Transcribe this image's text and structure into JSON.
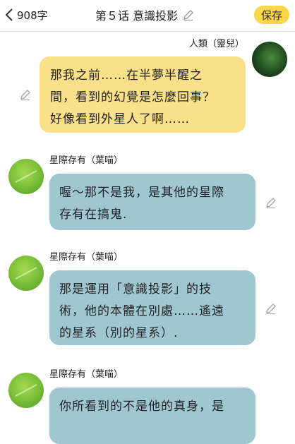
{
  "header": {
    "back_icon": "chevron-left-icon",
    "word_count": "908字",
    "title": "第５话 意識投影",
    "save_label": "保存"
  },
  "messages": [
    {
      "side": "right",
      "sender": "人類（靈兒）",
      "lines": [
        "那我之前……在半夢半醒之",
        "間，看到的幻覺是怎麼回事？",
        "好像看到外星人了啊……"
      ]
    },
    {
      "side": "left",
      "sender": "星際存有（葉喵）",
      "lines": [
        "喔～那不是我，是其他的星際",
        "存有在搞鬼."
      ]
    },
    {
      "side": "left",
      "sender": "星際存有（葉喵）",
      "lines": [
        "那是運用「意識投影」的技",
        "術，他的本體在別處……遙遠",
        "的星系（別的星系）."
      ]
    },
    {
      "side": "left",
      "sender": "星際存有（葉喵）",
      "lines": [
        "你所看到的不是他的真身，是"
      ]
    }
  ],
  "colors": {
    "save_button": "#f9d64a",
    "right_bubble": "#fbe08a",
    "left_bubble": "#9fc7d2"
  }
}
